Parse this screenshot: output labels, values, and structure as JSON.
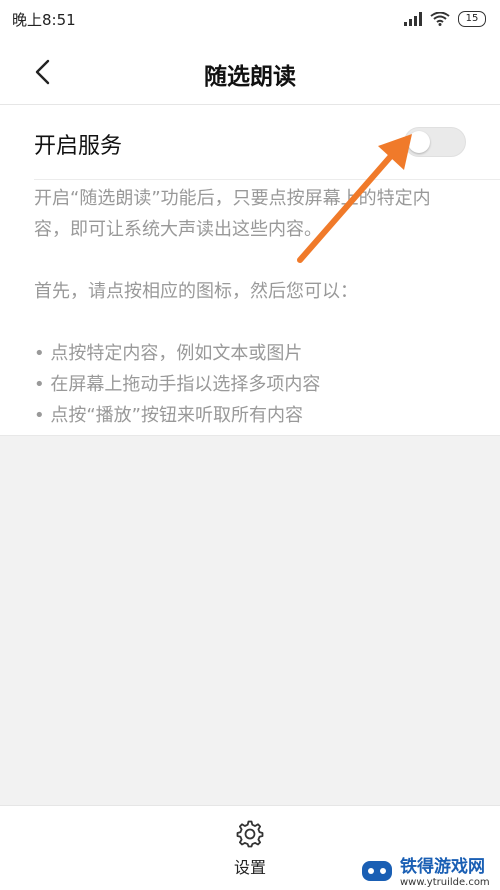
{
  "status_bar": {
    "time": "晚上8:51",
    "battery": "15"
  },
  "header": {
    "title": "随选朗读"
  },
  "service": {
    "label": "开启服务",
    "enabled": false
  },
  "description": {
    "intro": "开启“随选朗读”功能后，只要点按屏幕上的特定内容，即可让系统大声读出这些内容。",
    "first": "首先，请点按相应的图标，然后您可以：",
    "bullets": [
      "• 点按特定内容，例如文本或图片",
      "• 在屏幕上拖动手指以选择多项内容",
      "• 点按“播放”按钮来听取所有内容"
    ]
  },
  "bottom": {
    "settings_label": "设置"
  },
  "watermark": {
    "name": "铁得游戏网",
    "url": "www.ytruilde.com"
  },
  "colors": {
    "arrow": "#f07a2a",
    "toggle_off": "#eaeaea",
    "desc_text": "#999999"
  }
}
